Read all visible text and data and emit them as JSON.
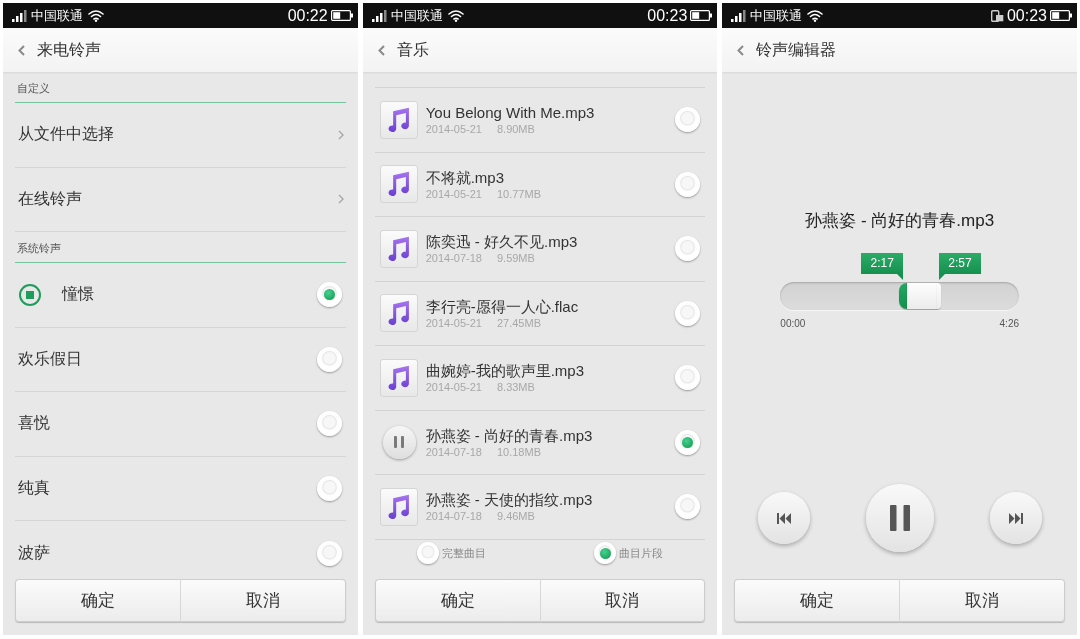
{
  "screens": [
    {
      "kind": "ringtone_list",
      "status_bar": {
        "carrier": "中国联通",
        "time": "00:22"
      },
      "title": "来电铃声",
      "sections": [
        {
          "header": "自定义",
          "items": [
            {
              "kind": "link",
              "label": "从文件中选择"
            },
            {
              "kind": "link",
              "label": "在线铃声"
            }
          ]
        },
        {
          "header": "系统铃声",
          "items": [
            {
              "kind": "radio",
              "label": "憧憬",
              "selected": true,
              "playing": true
            },
            {
              "kind": "radio",
              "label": "欢乐假日",
              "selected": false,
              "playing": false
            },
            {
              "kind": "radio",
              "label": "喜悦",
              "selected": false,
              "playing": false
            },
            {
              "kind": "radio",
              "label": "纯真",
              "selected": false,
              "playing": false
            },
            {
              "kind": "radio",
              "label": "波萨",
              "selected": false,
              "playing": false
            }
          ]
        }
      ],
      "buttons": [
        "确定",
        "取消"
      ]
    },
    {
      "kind": "file_list",
      "status_bar": {
        "carrier": "中国联通",
        "time": "00:23"
      },
      "title": "音乐",
      "files": [
        {
          "name": "You Belong With Me.mp3",
          "date": "2014-05-21",
          "size": "8.90MB",
          "selected": false,
          "playing": false
        },
        {
          "name": "不将就.mp3",
          "date": "2014-05-21",
          "size": "10.77MB",
          "selected": false,
          "playing": false
        },
        {
          "name": "陈奕迅 - 好久不见.mp3",
          "date": "2014-07-18",
          "size": "9.59MB",
          "selected": false,
          "playing": false
        },
        {
          "name": "李行亮-愿得一人心.flac",
          "date": "2014-05-21",
          "size": "27.45MB",
          "selected": false,
          "playing": false
        },
        {
          "name": "曲婉婷-我的歌声里.mp3",
          "date": "2014-05-21",
          "size": "8.33MB",
          "selected": false,
          "playing": false
        },
        {
          "name": "孙燕姿 - 尚好的青春.mp3",
          "date": "2014-07-18",
          "size": "10.18MB",
          "selected": true,
          "playing": true
        },
        {
          "name": "孙燕姿 - 天使的指纹.mp3",
          "date": "2014-07-18",
          "size": "9.46MB",
          "selected": false,
          "playing": false
        }
      ],
      "clip_options": [
        {
          "label": "完整曲目",
          "selected": false
        },
        {
          "label": "曲目片段",
          "selected": true
        }
      ],
      "buttons": [
        "确定",
        "取消"
      ]
    },
    {
      "kind": "editor",
      "status_bar": {
        "carrier": "中国联通",
        "time": "00:23",
        "device_icon": true
      },
      "title": "铃声编辑器",
      "song": "孙燕姿 - 尚好的青春.mp3",
      "handles": [
        {
          "label": "2:17",
          "level": 0.515
        },
        {
          "label": "2:57",
          "level": 0.665
        }
      ],
      "start_time": "00:00",
      "end_time": "4:26",
      "player": {
        "playing": true
      },
      "buttons": [
        "确定",
        "取消"
      ]
    }
  ]
}
